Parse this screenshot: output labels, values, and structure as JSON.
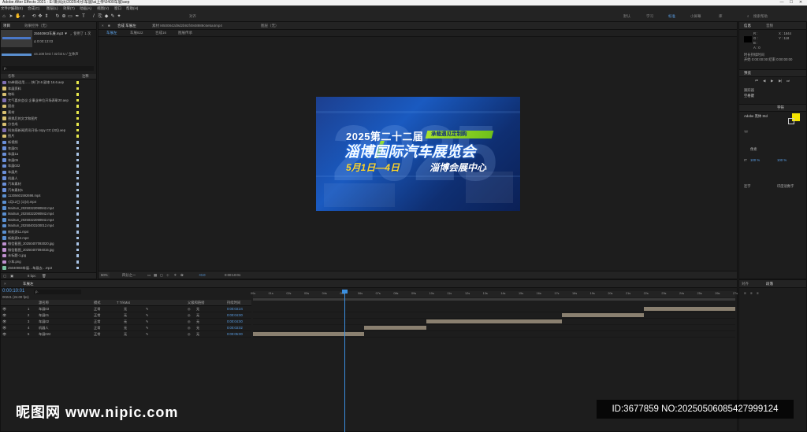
{
  "window": {
    "title": "Adobe After Effects 2021 - E:\\新闻页\\2025\\4月\\车展\\ai上传\\0409车展\\aep",
    "minimize": "—",
    "maximize": "☐",
    "close": "✕"
  },
  "menu": [
    "文件(F)",
    "编辑(E)",
    "合成(C)",
    "图层(L)",
    "效果(T)",
    "动画(A)",
    "视图(V)",
    "窗口",
    "帮助(H)"
  ],
  "toolbar": {
    "snap_label": "对齐",
    "workspaces": [
      "默认",
      "学习",
      "标准",
      "小屏幕",
      "库"
    ],
    "active_workspace": "标准",
    "search_placeholder": "搜索帮助"
  },
  "project_panel": {
    "tab_project": "项目",
    "tab_effects": "效果控件（无）",
    "selected_name": "25040903车展.mp3 ▼",
    "used_count": "，使用了 1 次",
    "duration": "Δ 0:00:13:03",
    "audio_info": "44.100 kHz / 32 bit U / 立体声",
    "search_placeholder": "ρ.",
    "col_name": "名称",
    "col_comment": "注释",
    "items": [
      {
        "name": "0a单图适用……快门0.6 副本 16.6.aep",
        "color": "#7f6fb3",
        "tag": "#e8e84a"
      },
      {
        "name": "车展资料",
        "color": "#d8c070",
        "tag": "#e8e84a"
      },
      {
        "name": "物料",
        "color": "#d8c070",
        "tag": "#e8e84a"
      },
      {
        "name": "大气喜庆会议 企事业单位开场表彰20.aep",
        "color": "#7f6fb3",
        "tag": "#e8e84a"
      },
      {
        "name": "固态",
        "color": "#d8c070",
        "tag": "#e8e84a"
      },
      {
        "name": "素材",
        "color": "#d8c070",
        "tag": "#e8e84a"
      },
      {
        "name": "替换后的文字和图片",
        "color": "#d8c070",
        "tag": "#e8e84a"
      },
      {
        "name": "分合成",
        "color": "#d8c070",
        "tag": "#e8e84a"
      },
      {
        "name": "科技感新闻资讯开场 copy CC (22)).aep",
        "color": "#7f6fb3",
        "tag": "#e8e84a"
      },
      {
        "name": "图片",
        "color": "#d8c070",
        "tag": "#e8e84a"
      },
      {
        "name": "新视频",
        "color": "#6a8fd8",
        "tag": "#a9c4e6"
      },
      {
        "name": "车展01",
        "color": "#6a8fd8",
        "tag": "#a9c4e6"
      },
      {
        "name": "车展1a",
        "color": "#6a8fd8",
        "tag": "#a9c4e6"
      },
      {
        "name": "车展05",
        "color": "#6a8fd8",
        "tag": "#a9c4e6"
      },
      {
        "name": "车展022",
        "color": "#6a8fd8",
        "tag": "#a9c4e6"
      },
      {
        "name": "车展片",
        "color": "#6a8fd8",
        "tag": "#a9c4e6"
      },
      {
        "name": "机器人",
        "color": "#6a8fd8",
        "tag": "#a9c4e6"
      },
      {
        "name": "汽车素材",
        "color": "#6a8fd8",
        "tag": "#a9c4e6"
      },
      {
        "name": "汽车素材1",
        "color": "#6a8fd8",
        "tag": "#a9c4e6"
      },
      {
        "name": "11305601592698.mp4",
        "color": "#5a8fd0",
        "tag": "#a9c4e6"
      },
      {
        "name": "1月12日 (1)(4).mp4",
        "color": "#5a8fd0",
        "tag": "#a9c4e6"
      },
      {
        "name": "MaiSun_20250322090942.mp4",
        "color": "#5a8fd0",
        "tag": "#a9c4e6"
      },
      {
        "name": "MaiSun_20250322090942.mp4",
        "color": "#5a8fd0",
        "tag": "#a9c4e6"
      },
      {
        "name": "MaiSun_20250322090942.mp4",
        "color": "#5a8fd0",
        "tag": "#a9c4e6"
      },
      {
        "name": "MaiSun_20250403100012.mp4",
        "color": "#5a8fd0",
        "tag": "#a9c4e6"
      },
      {
        "name": "新能源11.mp4",
        "color": "#5a8fd0",
        "tag": "#a9c4e6"
      },
      {
        "name": "新能源12.mp4",
        "color": "#5a8fd0",
        "tag": "#a9c4e6"
      },
      {
        "name": "微信截图_20250407093020.jpg",
        "color": "#c090d0",
        "tag": "#a9c4e6"
      },
      {
        "name": "微信截图_20250407094015.jpg",
        "color": "#c090d0",
        "tag": "#a9c4e6"
      },
      {
        "name": "未标题-1.jpg",
        "color": "#c090d0",
        "tag": "#a9c4e6"
      },
      {
        "name": "小车.png",
        "color": "#c090d0",
        "tag": "#a9c4e6"
      },
      {
        "name": "25040903车展…车展去…mp3",
        "color": "#7ac0a0",
        "tag": "#a9c4e6"
      }
    ],
    "footer_bpc": "8 bpc"
  },
  "viewer": {
    "comp_tab": "合成 车展左",
    "footage_tab": "素材 M500842d9d2b92f4948989c6e5a4mp4",
    "layer_tab": "图层（无）",
    "sub_tabs": [
      "车展左",
      "车展822",
      "合成16",
      "图展传承"
    ],
    "zoom": "50%",
    "resolution": "四分之一",
    "timecode": "0:00:10:01",
    "exposure": "+0.0",
    "content": {
      "bg_digits": "2025",
      "headline1": "2025第二十二届",
      "banner": "承载遇见定制购",
      "headline2": "淄博国际汽车展览会",
      "date": "5月1日—4日",
      "venue": "淄博会展中心"
    }
  },
  "right_panel": {
    "info_tab": "信息",
    "audio_tab": "音频",
    "color_r": "R :",
    "color_g": "G :",
    "color_b": "B :",
    "color_a": "A : 0",
    "coord_x": "X : 1844",
    "coord_y": "Y : 118",
    "quote_label": "时长持续时间",
    "time_range": "开始 0:00:00:00  结束 0:00:00:00",
    "preview_tab": "预览",
    "tracker_tab": "跟踪器",
    "tracker_label": "空格键",
    "character_tab": "字符",
    "font_name": "Adobe 黑体 Std",
    "font_size": "像素",
    "percent_a": "100 %",
    "percent_b": "100 %",
    "checkbox_a": "连字",
    "checkbox_b": "印度语数字"
  },
  "timeline": {
    "tab": "车展左",
    "timecode": "0:00:10:01",
    "fps": "00241 (24.00 fps)",
    "search_placeholder": "ρ.",
    "col_name": "源名称",
    "col_mode": "模式",
    "col_trkmat": "T TrkMat",
    "col_parent": "父级和链接",
    "col_duration": "持续时间",
    "layers": [
      {
        "num": "1",
        "name": "车展03",
        "mode": "正常",
        "matte": "无",
        "parent": "无",
        "duration": "0:00:03:24"
      },
      {
        "num": "2",
        "name": "车展01",
        "mode": "正常",
        "matte": "无",
        "parent": "无",
        "duration": "0:00:04:00"
      },
      {
        "num": "3",
        "name": "车展02",
        "mode": "正常",
        "matte": "无",
        "parent": "无",
        "duration": "0:00:04:00"
      },
      {
        "num": "4",
        "name": "机器人",
        "mode": "正常",
        "matte": "无",
        "parent": "无",
        "duration": "0:00:03:02"
      },
      {
        "num": "5",
        "name": "车展022",
        "mode": "正常",
        "matte": "无",
        "parent": "无",
        "duration": "0:00:05:00"
      }
    ],
    "layer_bars": [
      {
        "start": 0.81,
        "end": 1.0
      },
      {
        "start": 0.64,
        "end": 0.81
      },
      {
        "start": 0.36,
        "end": 0.64
      },
      {
        "start": 0.23,
        "end": 0.36
      },
      {
        "start": 0.0,
        "end": 0.23
      }
    ],
    "ruler": [
      "00s",
      "01s",
      "02s",
      "03s",
      "04s",
      "05s",
      "06s",
      "07s",
      "08s",
      "09s",
      "10s",
      "11s",
      "12s",
      "13s",
      "14s",
      "15s",
      "16s",
      "17s",
      "18s",
      "19s",
      "20s",
      "21s",
      "22s",
      "23s",
      "24s",
      "25s",
      "26s",
      "27s"
    ],
    "playhead_fraction": 0.195
  },
  "bottom_right": {
    "tab_align": "对齐",
    "tab_para": "段落"
  },
  "watermark": {
    "left": "昵图网 www.nipic.com",
    "right": "ID:3677859 NO:20250506085427999124"
  }
}
